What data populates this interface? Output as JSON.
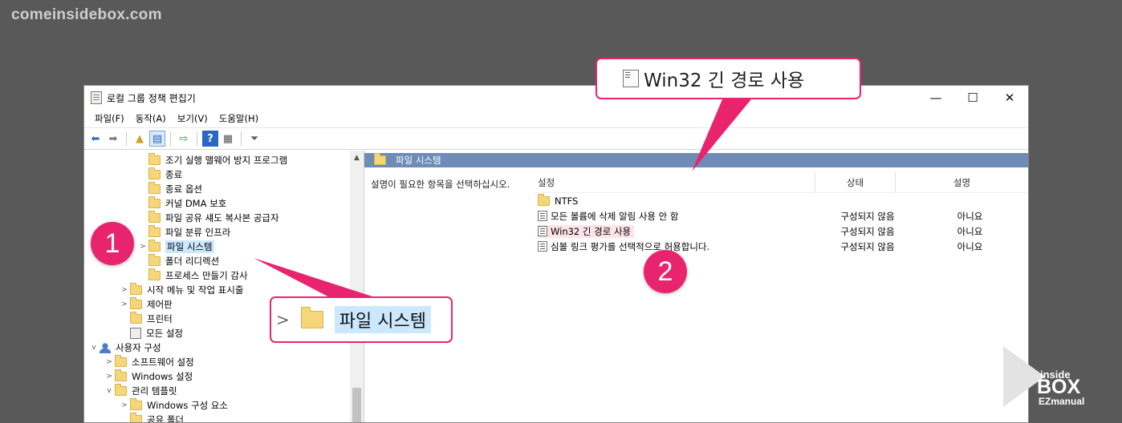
{
  "site_logo": "comeinsidebox.com",
  "window": {
    "title": "로컬 그룹 정책 편집기",
    "controls": {
      "minimize": "—",
      "maximize": "☐",
      "close": "✕"
    }
  },
  "menu": [
    "파일(F)",
    "동작(A)",
    "보기(V)",
    "도움말(H)"
  ],
  "tree": {
    "items": [
      {
        "label": "조기 실행 맬웨어 방지 프로그램"
      },
      {
        "label": "종료"
      },
      {
        "label": "종료 옵션"
      },
      {
        "label": "커널 DMA 보호"
      },
      {
        "label": "파일 공유 섀도 복사본 공급자"
      },
      {
        "label": "파일 분류 인프라"
      },
      {
        "label": "파일 시스템"
      },
      {
        "label": "폴더 리디렉션"
      },
      {
        "label": "프로세스 만들기 감사"
      },
      {
        "label": "시작 메뉴 및 작업 표시줄"
      },
      {
        "label": "제어판"
      },
      {
        "label": "프린터"
      },
      {
        "label": "모든 설정"
      },
      {
        "label": "사용자 구성"
      },
      {
        "label": "소프트웨어 설정"
      },
      {
        "label": "Windows 설정"
      },
      {
        "label": "관리 템플릿"
      },
      {
        "label": "Windows 구성 요소"
      },
      {
        "label": "공유 폴더"
      }
    ]
  },
  "right": {
    "header": "파일 시스템",
    "description": "설명이 필요한 항목을 선택하십시오.",
    "columns": {
      "setting": "설정",
      "state": "상태",
      "comment": "설명"
    },
    "rows": [
      {
        "name": "NTFS",
        "state": "",
        "comment": ""
      },
      {
        "name": "모든 볼륨에 삭제 알림 사용 안 함",
        "state": "구성되지 않음",
        "comment": "아니요"
      },
      {
        "name": "Win32 긴 경로 사용",
        "state": "구성되지 않음",
        "comment": "아니요"
      },
      {
        "name": "심볼 링크 평가를 선택적으로 허용합니다.",
        "state": "구성되지 않음",
        "comment": "아니요"
      }
    ]
  },
  "callouts": {
    "top": "Win32 긴 경로 사용",
    "bottom": "파일 시스템"
  },
  "badges": {
    "one": "1",
    "two": "2"
  },
  "brand": {
    "line1": "inside",
    "line2": "BOX",
    "line3": "EZmanual"
  },
  "colors": {
    "accent": "#e8246f",
    "header_bar": "#6e8cb5",
    "selection": "#cce8ff"
  }
}
